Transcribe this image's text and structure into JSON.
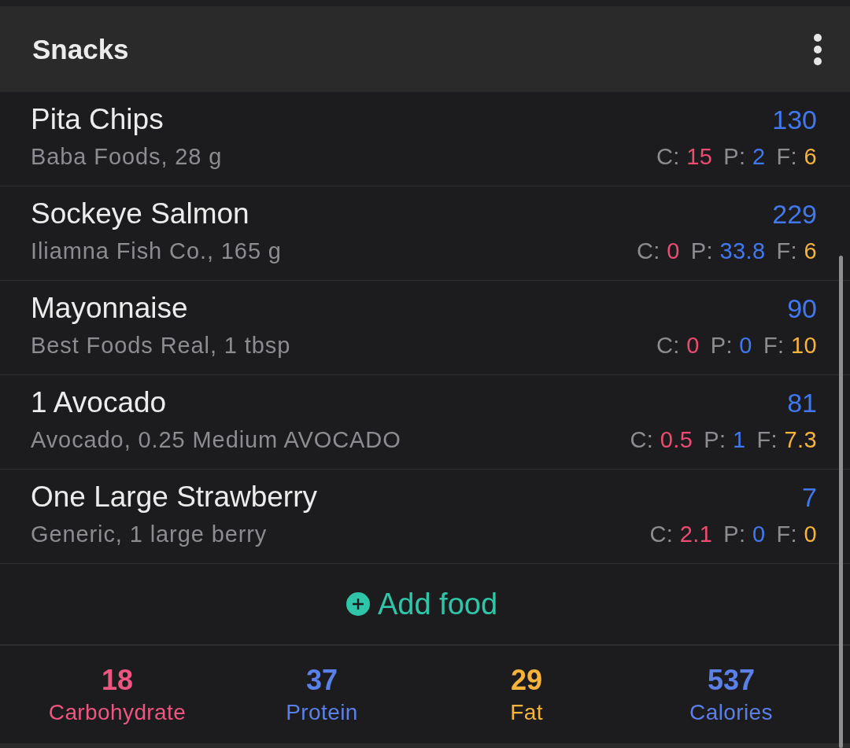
{
  "header": {
    "title": "Snacks"
  },
  "foods": [
    {
      "name": "Pita Chips",
      "detail": "Baba Foods, 28 g",
      "calories": "130",
      "macros": [
        {
          "kind": "carbs",
          "label": "C:",
          "value": "15"
        },
        {
          "kind": "protein",
          "label": "P:",
          "value": "2"
        },
        {
          "kind": "fat",
          "label": "F:",
          "value": "6"
        }
      ]
    },
    {
      "name": "Sockeye Salmon",
      "detail": "Iliamna Fish Co., 165 g",
      "calories": "229",
      "macros": [
        {
          "kind": "carbs",
          "label": "C:",
          "value": "0"
        },
        {
          "kind": "protein",
          "label": "P:",
          "value": "33.8"
        },
        {
          "kind": "fat",
          "label": "F:",
          "value": "6"
        }
      ]
    },
    {
      "name": "Mayonnaise",
      "detail": "Best Foods Real, 1 tbsp",
      "calories": "90",
      "macros": [
        {
          "kind": "carbs",
          "label": "C:",
          "value": "0"
        },
        {
          "kind": "protein",
          "label": "P:",
          "value": "0"
        },
        {
          "kind": "fat",
          "label": "F:",
          "value": "10"
        }
      ]
    },
    {
      "name": "1 Avocado",
      "detail": "Avocado, 0.25 Medium AVOCADO",
      "calories": "81",
      "macros": [
        {
          "kind": "carbs",
          "label": "C:",
          "value": "0.5"
        },
        {
          "kind": "protein",
          "label": "P:",
          "value": "1"
        },
        {
          "kind": "fat",
          "label": "F:",
          "value": "7.3"
        }
      ]
    },
    {
      "name": "One Large Strawberry",
      "detail": "Generic, 1 large berry",
      "calories": "7",
      "macros": [
        {
          "kind": "carbs",
          "label": "C:",
          "value": "2.1"
        },
        {
          "kind": "protein",
          "label": "P:",
          "value": "0"
        },
        {
          "kind": "fat",
          "label": "F:",
          "value": "0"
        }
      ]
    }
  ],
  "add_food": {
    "label": "Add food"
  },
  "totals": [
    {
      "kind": "carbs",
      "value": "18",
      "label": "Carbohydrate"
    },
    {
      "kind": "protein",
      "value": "37",
      "label": "Protein"
    },
    {
      "kind": "fat",
      "value": "29",
      "label": "Fat"
    },
    {
      "kind": "calories",
      "value": "537",
      "label": "Calories"
    }
  ]
}
